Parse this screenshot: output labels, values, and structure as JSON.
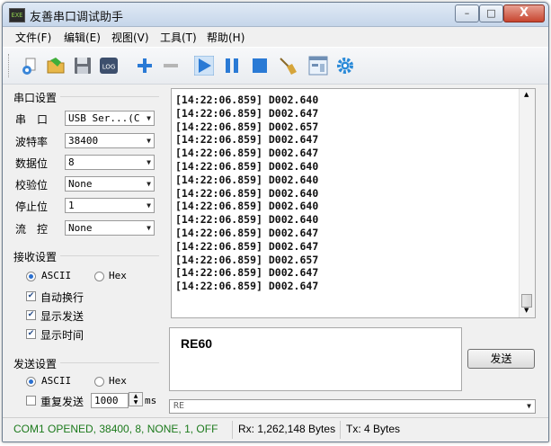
{
  "window": {
    "title": "友善串口调试助手",
    "icon_text": "EXE",
    "controls": {
      "minimize": "–",
      "maximize": "□",
      "close": "X"
    }
  },
  "menu": [
    "文件(F)",
    "编辑(E)",
    "视图(V)",
    "工具(T)",
    "帮助(H)"
  ],
  "toolbar": {
    "icons": [
      "new-config-icon",
      "open-folder-icon",
      "save-disk-icon",
      "log-icon",
      "add-plus-icon",
      "remove-minus-icon",
      "play-start-icon",
      "pause-icon",
      "stop-icon",
      "clear-broom-icon",
      "window-layout-icon",
      "settings-gear-icon"
    ],
    "log_label": "LOG",
    "colors": {
      "accent_blue": "#2a7ad5",
      "minus_gray": "#b5b5b5",
      "broom_yellow": "#d6a53a"
    }
  },
  "serial_settings": {
    "title": "串口设置",
    "port_label": "串　口",
    "port_value": "USB Ser...(C",
    "baud_label": "波特率",
    "baud_value": "38400",
    "databits_label": "数据位",
    "databits_value": "8",
    "parity_label": "校验位",
    "parity_value": "None",
    "stopbits_label": "停止位",
    "stopbits_value": "1",
    "flow_label": "流　控",
    "flow_value": "None"
  },
  "receive_settings": {
    "title": "接收设置",
    "ascii_label": "ASCII",
    "hex_label": "Hex",
    "mode_selected": "ASCII",
    "auto_wrap_label": "自动换行",
    "show_send_label": "显示发送",
    "show_time_label": "显示时间",
    "auto_wrap_checked": true,
    "show_send_checked": true,
    "show_time_checked": true
  },
  "send_settings": {
    "title": "发送设置",
    "ascii_label": "ASCII",
    "hex_label": "Hex",
    "mode_selected": "ASCII",
    "repeat_label": "重复发送",
    "repeat_checked": false,
    "interval_value": "1000",
    "interval_unit": "ms"
  },
  "receive_lines": [
    "[14:22:06.859] D002.640",
    "[14:22:06.859] D002.647",
    "[14:22:06.859] D002.657",
    "[14:22:06.859] D002.647",
    "[14:22:06.859] D002.647",
    "[14:22:06.859] D002.640",
    "[14:22:06.859] D002.640",
    "[14:22:06.859] D002.640",
    "[14:22:06.859] D002.640",
    "[14:22:06.859] D002.640",
    "[14:22:06.859] D002.647",
    "[14:22:06.859] D002.647",
    "[14:22:06.859] D002.657",
    "[14:22:06.859] D002.647",
    "[14:22:06.859] D002.647"
  ],
  "send": {
    "text": "RE60",
    "button_label": "发送",
    "history_value": "RE"
  },
  "status": {
    "connection": "COM1 OPENED, 38400, 8, NONE, 1, OFF",
    "rx": "Rx: 1,262,148 Bytes",
    "tx": "Tx: 4 Bytes",
    "connection_color": "#1c7a1c"
  }
}
